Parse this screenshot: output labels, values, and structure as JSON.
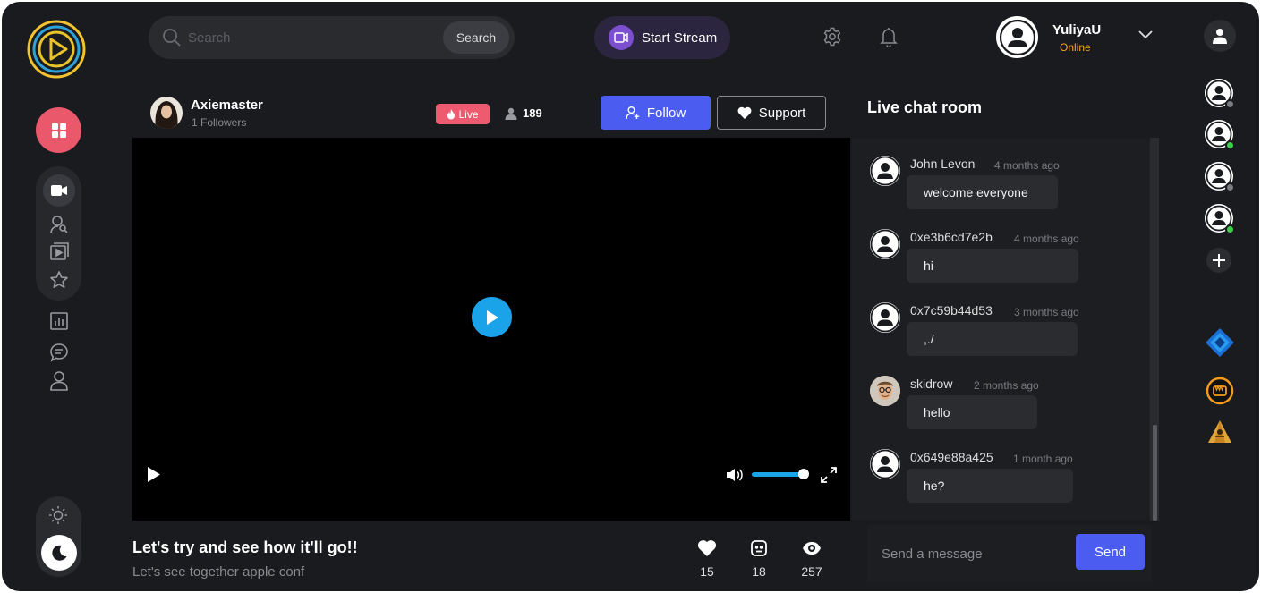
{
  "search": {
    "placeholder": "Search",
    "button_label": "Search"
  },
  "header": {
    "start_stream_label": "Start Stream"
  },
  "user": {
    "name": "YuliyaU",
    "status": "Online"
  },
  "streamer": {
    "name": "Axiemaster",
    "followers": "1 Followers",
    "live_label": "Live",
    "viewer_count": "189"
  },
  "actions": {
    "follow_label": "Follow",
    "support_label": "Support"
  },
  "video": {
    "volume_level": 1.0
  },
  "stream": {
    "title": "Let's try and see how it'll go!!",
    "subtitle": "Let's see together apple conf",
    "likes": "15",
    "comments": "18",
    "views": "257"
  },
  "chat": {
    "title": "Live chat room",
    "messages": [
      {
        "user": "John Levon",
        "time": "4 months ago",
        "text": "welcome everyone"
      },
      {
        "user": "0xe3b6cd7e2b",
        "time": "4 months ago",
        "text": "hi"
      },
      {
        "user": "0x7c59b44d53",
        "time": "3 months ago",
        "text": ",./"
      },
      {
        "user": "skidrow",
        "time": "2 months ago",
        "text": "hello"
      },
      {
        "user": "0x649e88a425",
        "time": "1 month ago",
        "text": "he?"
      }
    ],
    "input_placeholder": "Send a message",
    "send_label": "Send"
  },
  "right_rail": {
    "friends": [
      {
        "status": "offline",
        "status_color": "#7a7b80"
      },
      {
        "status": "online",
        "status_color": "#3ecf4a"
      },
      {
        "status": "offline",
        "status_color": "#7a7b80"
      },
      {
        "status": "online",
        "status_color": "#3ecf4a"
      }
    ]
  },
  "colors": {
    "accent": "#4b5cf0",
    "live": "#ee5a6f",
    "play": "#1aa3e8",
    "home": "#e9586b",
    "online": "#f5a623"
  }
}
